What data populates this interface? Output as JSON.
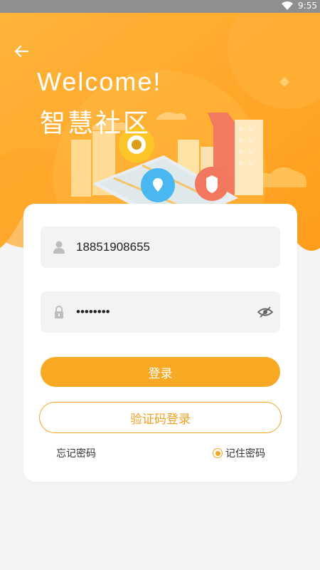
{
  "status_bar": {
    "time": "9:55"
  },
  "header": {
    "title": "Welcome!",
    "subtitle": "智慧社区"
  },
  "form": {
    "phone_value": "18851908655",
    "password_value": "12345678",
    "login_label": "登录",
    "code_login_label": "验证码登录",
    "forgot_label": "忘记密码",
    "remember_label": "记住密码",
    "remember_checked": true
  },
  "icons": {
    "back": "back-arrow-icon",
    "user": "user-icon",
    "lock": "lock-icon",
    "eye": "eye-hidden-icon",
    "wifi": "wifi-icon"
  },
  "colors": {
    "accent": "#f8a923",
    "accent_border": "#f5a623",
    "background": "#f4f4f4"
  }
}
